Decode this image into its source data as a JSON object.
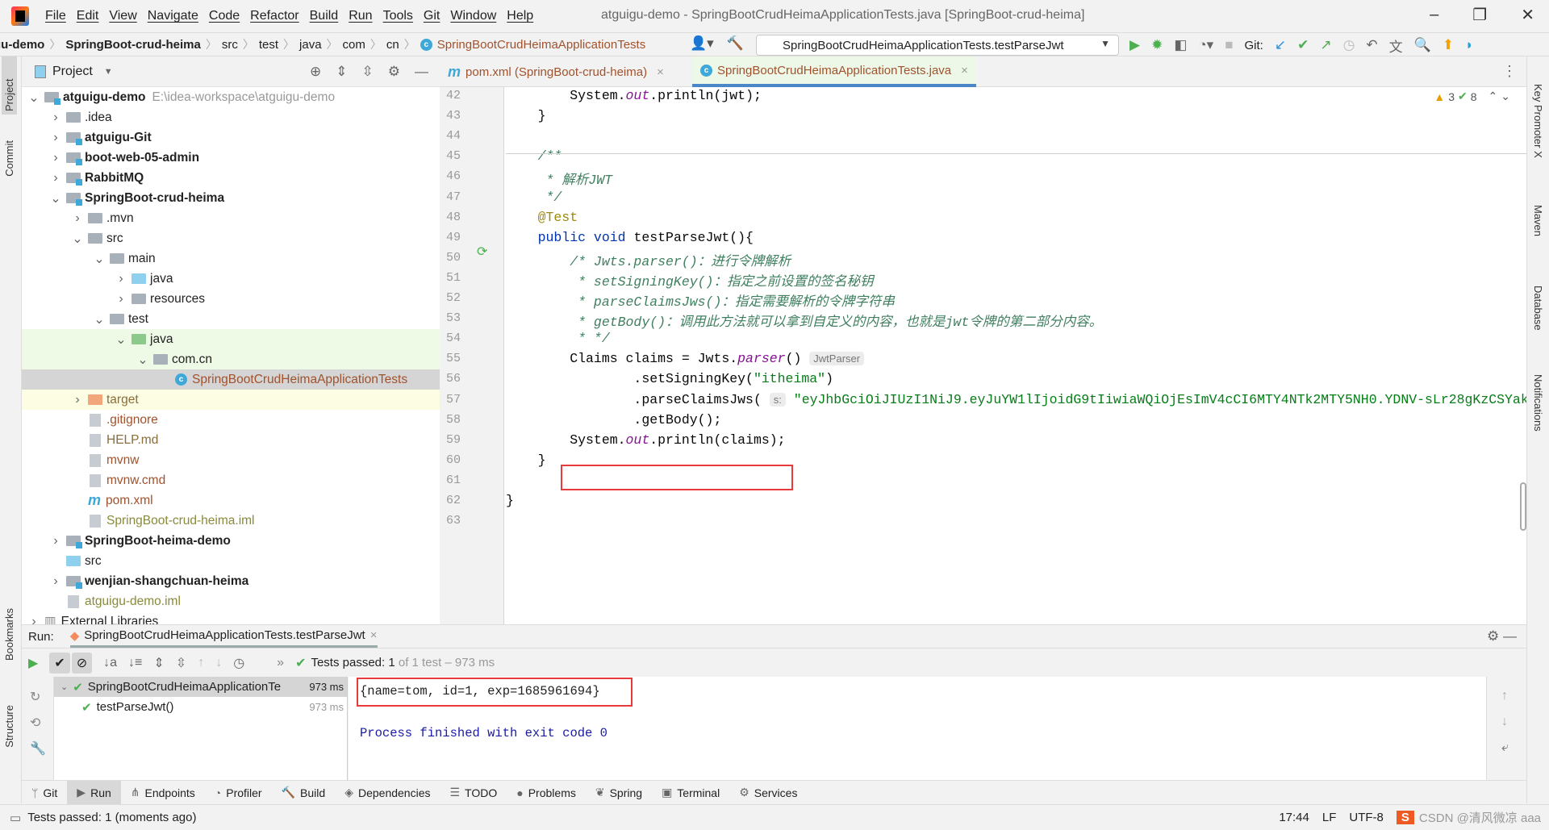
{
  "menubar": {
    "items": [
      "File",
      "Edit",
      "View",
      "Navigate",
      "Code",
      "Refactor",
      "Build",
      "Run",
      "Tools",
      "Git",
      "Window",
      "Help"
    ],
    "title": "atguigu-demo - SpringBootCrudHeimaApplicationTests.java [SpringBoot-crud-heima]"
  },
  "breadcrumb": [
    "gu-demo",
    "SpringBoot-crud-heima",
    "src",
    "test",
    "java",
    "com",
    "cn",
    "SpringBootCrudHeimaApplicationTests"
  ],
  "toolbar": {
    "run_config": "SpringBootCrudHeimaApplicationTests.testParseJwt",
    "git_label": "Git:"
  },
  "project": {
    "title": "Project",
    "tree": [
      {
        "label": "atguigu-demo",
        "path": "E:\\idea-workspace\\atguigu-demo",
        "depth": 0,
        "arrow": "open",
        "icon": "module",
        "bold": true
      },
      {
        "label": ".idea",
        "depth": 1,
        "arrow": "closed",
        "icon": "folder"
      },
      {
        "label": "atguigu-Git",
        "depth": 1,
        "arrow": "closed",
        "icon": "module",
        "bold": true
      },
      {
        "label": "boot-web-05-admin",
        "depth": 1,
        "arrow": "closed",
        "icon": "module",
        "bold": true
      },
      {
        "label": "RabbitMQ",
        "depth": 1,
        "arrow": "closed",
        "icon": "module",
        "bold": true
      },
      {
        "label": "SpringBoot-crud-heima",
        "depth": 1,
        "arrow": "open",
        "icon": "module",
        "bold": true
      },
      {
        "label": ".mvn",
        "depth": 2,
        "arrow": "closed",
        "icon": "folder"
      },
      {
        "label": "src",
        "depth": 2,
        "arrow": "open",
        "icon": "folder"
      },
      {
        "label": "main",
        "depth": 3,
        "arrow": "open",
        "icon": "folder"
      },
      {
        "label": "java",
        "depth": 4,
        "arrow": "closed",
        "icon": "src"
      },
      {
        "label": "resources",
        "depth": 4,
        "arrow": "closed",
        "icon": "folder"
      },
      {
        "label": "test",
        "depth": 3,
        "arrow": "open",
        "icon": "folder"
      },
      {
        "label": "java",
        "depth": 4,
        "arrow": "open",
        "icon": "test",
        "bg": "#eef9e6"
      },
      {
        "label": "com.cn",
        "depth": 5,
        "arrow": "open",
        "icon": "folder",
        "bg": "#eef9e6"
      },
      {
        "label": "SpringBootCrudHeimaApplicationTests",
        "depth": 6,
        "icon": "class",
        "color": "#a0522d",
        "bg": "#d5d5d5"
      },
      {
        "label": "target",
        "depth": 2,
        "arrow": "closed",
        "icon": "target",
        "color": "#8a6d3b",
        "bg": "#fdfde4"
      },
      {
        "label": ".gitignore",
        "depth": 2,
        "icon": "file",
        "color": "#a0522d"
      },
      {
        "label": "HELP.md",
        "depth": 2,
        "icon": "file",
        "color": "#8a6d3b"
      },
      {
        "label": "mvnw",
        "depth": 2,
        "icon": "file",
        "color": "#a0522d"
      },
      {
        "label": "mvnw.cmd",
        "depth": 2,
        "icon": "file",
        "color": "#a0522d"
      },
      {
        "label": "pom.xml",
        "depth": 2,
        "icon": "maven",
        "color": "#a0522d"
      },
      {
        "label": "SpringBoot-crud-heima.iml",
        "depth": 2,
        "icon": "file",
        "color": "#8a8a3b"
      },
      {
        "label": "SpringBoot-heima-demo",
        "depth": 1,
        "arrow": "closed",
        "icon": "module",
        "bold": true
      },
      {
        "label": "src",
        "depth": 1,
        "icon": "src"
      },
      {
        "label": "wenjian-shangchuan-heima",
        "depth": 1,
        "arrow": "closed",
        "icon": "module",
        "bold": true
      },
      {
        "label": "atguigu-demo.iml",
        "depth": 1,
        "icon": "file",
        "color": "#8a8a3b"
      },
      {
        "label": "External Libraries",
        "depth": 0,
        "arrow": "closed",
        "icon": "lib"
      }
    ]
  },
  "editor": {
    "tabs": [
      {
        "label": "pom.xml (SpringBoot-crud-heima)",
        "icon": "maven"
      },
      {
        "label": "SpringBootCrudHeimaApplicationTests.java",
        "icon": "class",
        "active": true
      }
    ],
    "warnings": "3",
    "checks": "8",
    "lines": [
      {
        "n": "42",
        "t": [
          [
            "",
            "        System."
          ],
          [
            "fd",
            "out"
          ],
          [
            "",
            ".println(jwt);"
          ]
        ]
      },
      {
        "n": "43",
        "t": [
          [
            "",
            "    }"
          ]
        ]
      },
      {
        "n": "44",
        "t": []
      },
      {
        "n": "45",
        "t": [
          [
            "cm",
            "    /**"
          ]
        ]
      },
      {
        "n": "46",
        "t": [
          [
            "cm",
            "     * 解析JWT"
          ]
        ]
      },
      {
        "n": "47",
        "t": [
          [
            "cm",
            "     */"
          ]
        ]
      },
      {
        "n": "48",
        "t": [
          [
            "an",
            "    @Test"
          ]
        ]
      },
      {
        "n": "49",
        "t": [
          [
            "kw",
            "    public void "
          ],
          [
            "",
            "testParseJwt(){"
          ]
        ]
      },
      {
        "n": "50",
        "t": [
          [
            "cm",
            "        /* Jwts.parser()：进行令牌解析"
          ]
        ]
      },
      {
        "n": "51",
        "t": [
          [
            "cm",
            "         * setSigningKey()：指定之前设置的签名秘钥"
          ]
        ]
      },
      {
        "n": "52",
        "t": [
          [
            "cm",
            "         * parseClaimsJws()：指定需要解析的令牌字符串"
          ]
        ]
      },
      {
        "n": "53",
        "t": [
          [
            "cm",
            "         * getBody()：调用此方法就可以拿到自定义的内容，也就是jwt令牌的第二部分内容。"
          ]
        ]
      },
      {
        "n": "54",
        "t": [
          [
            "cm",
            "         * */"
          ]
        ]
      },
      {
        "n": "55",
        "t": [
          [
            "",
            "        Claims claims = Jwts."
          ],
          [
            "fd",
            "parser"
          ],
          [
            "",
            "() "
          ],
          [
            "hint",
            "JwtParser"
          ]
        ]
      },
      {
        "n": "56",
        "t": [
          [
            "",
            "                .setSigningKey("
          ],
          [
            "st",
            "\"itheima\""
          ],
          [
            "",
            ")"
          ]
        ]
      },
      {
        "n": "57",
        "t": [
          [
            "",
            "                .parseClaimsJws( "
          ],
          [
            "hint",
            "s:"
          ],
          [
            "st",
            " \"eyJhbGciOiJIUzI1NiJ9.eyJuYW1lIjoidG9tIiwiaWQiOjEsImV4cCI6MTY4NTk2MTY5NH0.YDNV-sLr28gKzCSYak"
          ]
        ]
      },
      {
        "n": "58",
        "t": [
          [
            "",
            "                .getBody();"
          ]
        ]
      },
      {
        "n": "59",
        "t": [
          [
            "",
            "        System."
          ],
          [
            "fd",
            "out"
          ],
          [
            "",
            ".println(claims);"
          ]
        ]
      },
      {
        "n": "60",
        "t": [
          [
            "",
            "    }"
          ]
        ]
      },
      {
        "n": "61",
        "t": []
      },
      {
        "n": "62",
        "t": [
          [
            "",
            "}"
          ]
        ]
      },
      {
        "n": "63",
        "t": []
      }
    ]
  },
  "run": {
    "label": "Run:",
    "tab": "SpringBootCrudHeimaApplicationTests.testParseJwt",
    "status_bold": "Tests passed: 1",
    "status_rest": " of 1 test – 973 ms",
    "tests": [
      {
        "name": "SpringBootCrudHeimaApplicationTe",
        "time": "973 ms"
      },
      {
        "name": "testParseJwt()",
        "time": "973 ms"
      }
    ],
    "output": [
      "{name=tom, id=1, exp=1685961694}",
      "",
      "Process finished with exit code 0"
    ]
  },
  "bottom_tools": [
    "Git",
    "Run",
    "Endpoints",
    "Profiler",
    "Build",
    "Dependencies",
    "TODO",
    "Problems",
    "Spring",
    "Terminal",
    "Services"
  ],
  "left_tabs": [
    "Project",
    "Commit",
    "Bookmarks",
    "Structure"
  ],
  "right_tabs": [
    "Key Promoter X",
    "Maven",
    "Database",
    "Notifications"
  ],
  "statusbar": {
    "message": "Tests passed: 1 (moments ago)",
    "position": "17:44",
    "line_sep": "LF",
    "encoding": "UTF-8",
    "watermark": "CSDN @清风微凉 aaa"
  },
  "colors": {
    "accent": "#4a86c8",
    "highlight_box": "#e8393b",
    "pass": "#4caf50"
  }
}
